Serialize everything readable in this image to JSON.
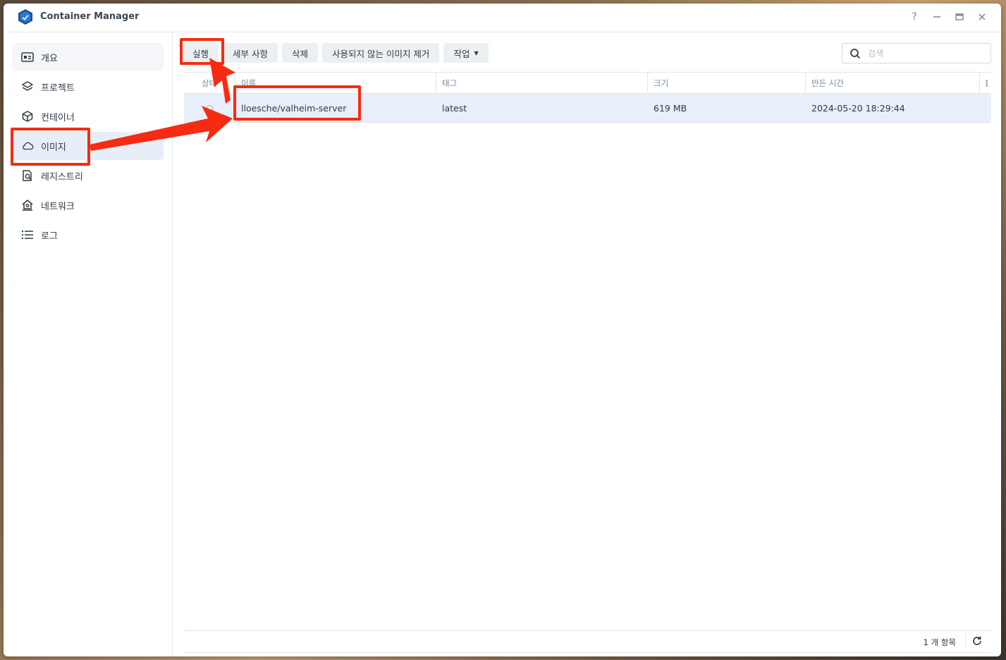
{
  "window": {
    "title": "Container Manager",
    "controls": {
      "help": "?",
      "minimize": "—",
      "maximize": "▭",
      "close": "✕"
    }
  },
  "sidebar": {
    "items": [
      {
        "label": "개요",
        "icon": "overview-icon"
      },
      {
        "label": "프로젝트",
        "icon": "layers-icon"
      },
      {
        "label": "컨테이너",
        "icon": "cube-icon"
      },
      {
        "label": "이미지",
        "icon": "cloud-icon",
        "active": true
      },
      {
        "label": "레지스트리",
        "icon": "registry-search-icon"
      },
      {
        "label": "네트워크",
        "icon": "network-house-icon"
      },
      {
        "label": "로그",
        "icon": "list-icon"
      }
    ]
  },
  "toolbar": {
    "run": "실행",
    "details": "세부 사항",
    "delete": "삭제",
    "remove_unused": "사용되지 않는 이미지 제거",
    "action": "작업"
  },
  "search": {
    "placeholder": "검색"
  },
  "table": {
    "headers": {
      "status": "상태",
      "name": "이름",
      "tag": "태그",
      "size": "크기",
      "created": "만든 시간"
    },
    "rows": [
      {
        "name": "lloesche/valheim-server",
        "tag": "latest",
        "size": "619 MB",
        "created": "2024-05-20 18:29:44"
      }
    ]
  },
  "footer": {
    "count": "1 개 항목"
  },
  "colors": {
    "accent": "#f62b12",
    "selected_row": "#e9effa",
    "active_nav": "#e8eef8"
  }
}
